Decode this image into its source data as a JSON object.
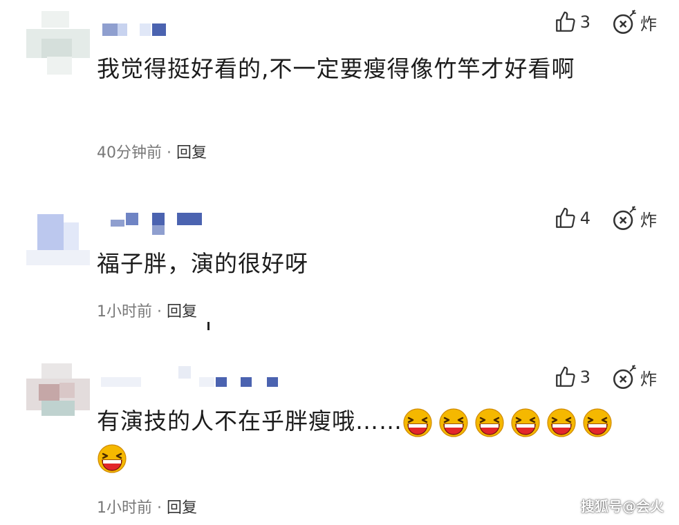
{
  "comments": [
    {
      "likes": "3",
      "bomb_label": "炸",
      "text": "我觉得挺好看的,不一定要瘦得像竹竿才好看啊",
      "time": "40分钟前",
      "separator": "·",
      "reply_label": "回复"
    },
    {
      "likes": "4",
      "bomb_label": "炸",
      "text": "福子胖，演的很好呀",
      "time": "1小时前",
      "separator": "·",
      "reply_label": "回复"
    },
    {
      "likes": "3",
      "bomb_label": "炸",
      "text": "有演技的人不在乎胖瘦哦……",
      "emoji_name": "laughing-face-emoji",
      "emoji_count": 7,
      "time": "1小时前",
      "separator": "·",
      "reply_label": "回复"
    }
  ],
  "watermark": "搜狐号@会火",
  "colors": {
    "blur_blue": "#4b63b0",
    "blur_light_blue": "#b9c8ee",
    "avatar_gray": "#e6ebe9",
    "emoji_yellow": "#f5b800",
    "emoji_mouth": "#e2262a"
  },
  "icons": {
    "like": "thumbs-up-icon",
    "bomb": "bomb-icon",
    "avatar": "pixelated-avatar"
  }
}
